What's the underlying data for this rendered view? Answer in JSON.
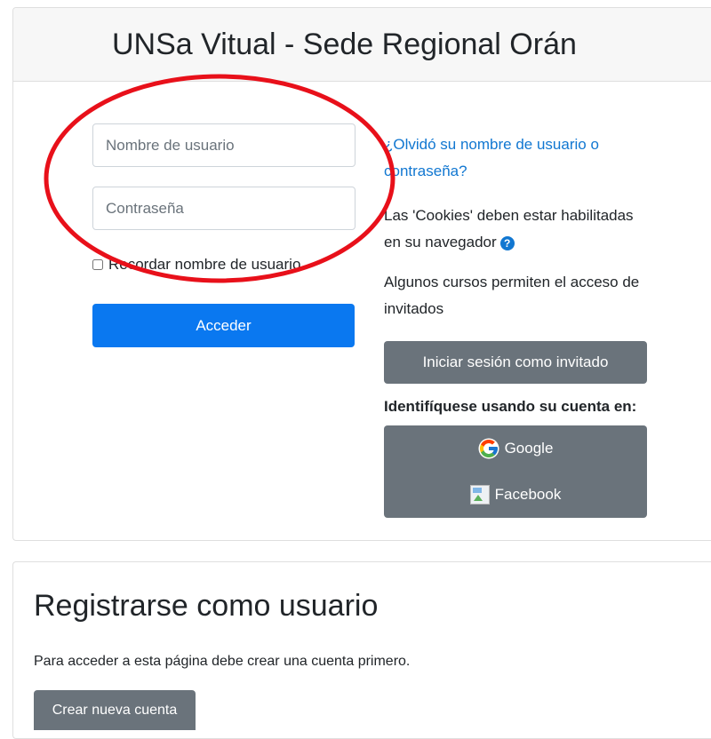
{
  "login": {
    "site_title": "UNSa Vitual - Sede Regional Orán",
    "username_placeholder": "Nombre de usuario",
    "username_value": "",
    "password_placeholder": "Contraseña",
    "password_value": "",
    "remember_label": "Recordar nombre de usuario",
    "remember_checked": false,
    "login_button": "Acceder",
    "forgot_link": "¿Olvidó su nombre de usuario o contraseña?",
    "cookies_notice": "Las 'Cookies' deben estar habilitadas en su navegador",
    "help_icon": "question-circle-icon",
    "guest_notice": "Algunos cursos permiten el acceso de invitados",
    "guest_button": "Iniciar sesión como invitado",
    "identify_label": "Identifíquese usando su cuenta en:",
    "providers": [
      {
        "label": "Google",
        "icon": "google-icon"
      },
      {
        "label": "Facebook",
        "icon": "broken-image-icon"
      }
    ]
  },
  "register": {
    "title": "Registrarse como usuario",
    "text": "Para acceder a esta página debe crear una cuenta primero.",
    "button": "Crear nueva cuenta"
  },
  "colors": {
    "primary": "#0a78f0",
    "secondary": "#6a737b",
    "link": "#1177d1",
    "annotation": "#e8101a"
  }
}
